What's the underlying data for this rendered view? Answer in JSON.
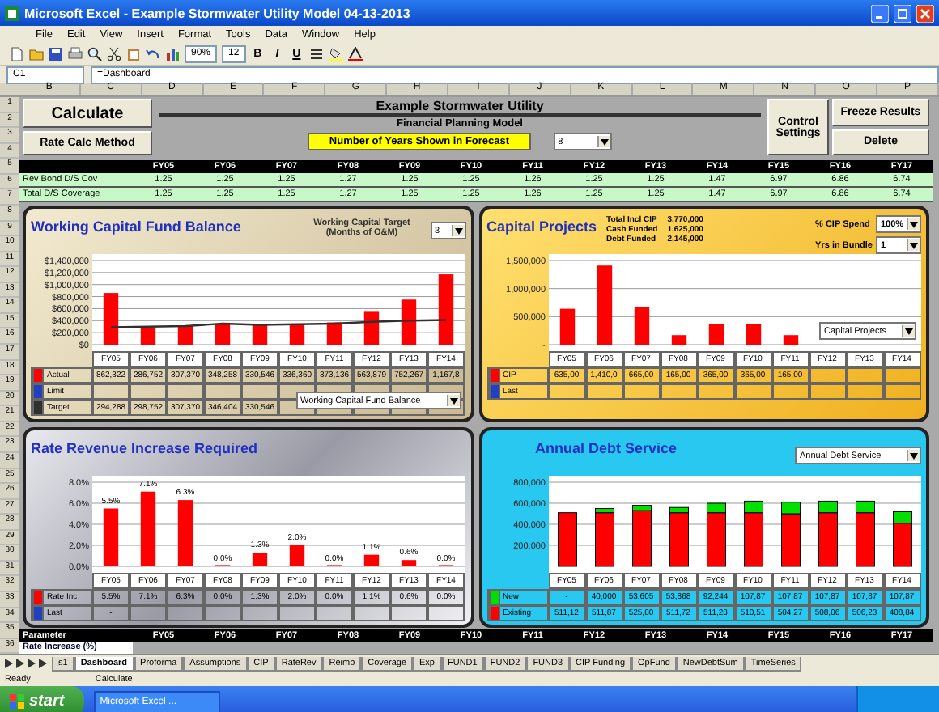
{
  "window": {
    "title": "Microsoft Excel - Example Stormwater Utility Model 04-13-2013"
  },
  "menu": [
    "File",
    "Edit",
    "View",
    "Insert",
    "Format",
    "Tools",
    "Data",
    "Window",
    "Help"
  ],
  "toolbar": {
    "zoom": "90%",
    "font_size": "12",
    "format_buttons": [
      "B",
      "I",
      "U"
    ]
  },
  "formula_bar": {
    "cell": "C1",
    "formula": "=Dashboard"
  },
  "columns": [
    "B",
    "C",
    "D",
    "E",
    "F",
    "G",
    "H",
    "I",
    "J",
    "K",
    "L",
    "M",
    "N",
    "O",
    "P"
  ],
  "row_numbers": [
    "1",
    "2",
    "3",
    "4",
    "5",
    "6",
    "7",
    "8",
    "9",
    "10",
    "11",
    "12",
    "13",
    "14",
    "15",
    "16",
    "17",
    "18",
    "19",
    "20",
    "21",
    "22",
    "23",
    "24",
    "25",
    "26",
    "27",
    "28",
    "29",
    "30",
    "31",
    "32",
    "33",
    "34",
    "35",
    "36"
  ],
  "header": {
    "calculate": "Calculate",
    "rate_calc": "Rate Calc Method",
    "title": "Example Stormwater Utility",
    "subtitle": "Financial Planning Model",
    "years_label": "Number of Years Shown in Forecast",
    "years_value": "8",
    "control_settings": "Control Settings",
    "freeze": "Freeze Results",
    "delete": "Delete"
  },
  "coverage": {
    "years": [
      "FY05",
      "FY06",
      "FY07",
      "FY08",
      "FY09",
      "FY10",
      "FY11",
      "FY12",
      "FY13",
      "FY14",
      "FY15",
      "FY16",
      "FY17"
    ],
    "rows": [
      {
        "label": "Rev Bond D/S Cov",
        "values": [
          "1.25",
          "1.25",
          "1.25",
          "1.27",
          "1.25",
          "1.25",
          "1.26",
          "1.25",
          "1.25",
          "1.47",
          "6.97",
          "6.86",
          "6.74"
        ]
      },
      {
        "label": "Total D/S Coverage",
        "values": [
          "1.25",
          "1.25",
          "1.25",
          "1.27",
          "1.25",
          "1.25",
          "1.26",
          "1.25",
          "1.25",
          "1.47",
          "6.97",
          "6.86",
          "6.74"
        ]
      }
    ]
  },
  "panels": [
    {
      "kind": "wcf",
      "title": "Working Capital Fund Balance",
      "target_label": "Working Capital Target (Months of O&M)",
      "target_value": "3",
      "selector": "Working Capital Fund Balance",
      "chart_data": {
        "type": "bar",
        "grid": true,
        "legend": "left",
        "categories": [
          "FY05",
          "FY06",
          "FY07",
          "FY08",
          "FY09",
          "FY10",
          "FY11",
          "FY12",
          "FY13",
          "FY14"
        ],
        "ylim": [
          0,
          1400000
        ],
        "yticks": [
          {
            "value": 0,
            "label": "$0"
          },
          {
            "value": 200000,
            "label": "$200,000"
          },
          {
            "value": 400000,
            "label": "$400,000"
          },
          {
            "value": 600000,
            "label": "$600,000"
          },
          {
            "value": 800000,
            "label": "$800,000"
          },
          {
            "value": 1000000,
            "label": "$1,000,000"
          },
          {
            "value": 1200000,
            "label": "$1,200,000"
          },
          {
            "value": 1400000,
            "label": "$1,400,000"
          }
        ],
        "series": [
          {
            "name": "Actual",
            "color": "#ff0000",
            "type": "bar",
            "values": [
              860000,
              290000,
              310000,
              350000,
              330000,
              340000,
              370000,
              560000,
              750000,
              1170000
            ]
          },
          {
            "name": "Target",
            "color": "#303030",
            "type": "line",
            "values": [
              290000,
              300000,
              310000,
              350000,
              330000,
              340000,
              350000,
              380000,
              400000,
              410000
            ]
          }
        ]
      },
      "table": {
        "rows": [
          {
            "kind": "series",
            "cells": [
              "862,322",
              "286,752",
              "307,370",
              "348,258",
              "330,546",
              "336,360",
              "373,136",
              "563,879",
              "752,267",
              "1,167,8"
            ]
          },
          {
            "kind": "extra",
            "label": "Limit",
            "color": "#2040c0",
            "cells": []
          },
          {
            "kind": "series",
            "cells": [
              "294,288",
              "298,752",
              "307,370",
              "346,404",
              "330,546"
            ]
          }
        ]
      }
    },
    {
      "kind": "capital",
      "title": "Capital Projects",
      "info": [
        {
          "label": "Total Incl CIP",
          "value": "3,770,000"
        },
        {
          "label": "Cash Funded",
          "value": "1,625,000"
        },
        {
          "label": "Debt Funded",
          "value": "2,145,000"
        }
      ],
      "options": [
        {
          "label": "% CIP Spend",
          "value": "100%"
        },
        {
          "label": "Yrs in Bundle",
          "value": "1"
        }
      ],
      "selector": "Capital Projects",
      "chart_data": {
        "type": "bar",
        "grid": true,
        "legend": "left",
        "categories": [
          "FY05",
          "FY06",
          "FY07",
          "FY08",
          "FY09",
          "FY10",
          "FY11",
          "FY12",
          "FY13",
          "FY14"
        ],
        "ylim": [
          0,
          1500000
        ],
        "yticks": [
          {
            "value": 0,
            "label": "-"
          },
          {
            "value": 500000,
            "label": "500,000"
          },
          {
            "value": 1000000,
            "label": "1,000,000"
          },
          {
            "value": 1500000,
            "label": "1,500,000"
          }
        ],
        "series": [
          {
            "name": "CIP",
            "color": "#ff0000",
            "type": "bar",
            "values": [
              640000,
              1410000,
              670000,
              170000,
              370000,
              370000,
              170000,
              null,
              null,
              null
            ]
          }
        ]
      },
      "table": {
        "rows": [
          {
            "kind": "series",
            "cells": [
              "635,00",
              "1,410,0",
              "665,00",
              "165,00",
              "365,00",
              "365,00",
              "165,00",
              "-",
              "-",
              "-"
            ]
          },
          {
            "kind": "extra",
            "label": "Last",
            "color": "#2040c0",
            "cells": []
          }
        ]
      }
    },
    {
      "kind": "rate",
      "title": "Rate Revenue Increase Required",
      "chart_data": {
        "type": "bar",
        "grid": true,
        "legend": "left",
        "categories": [
          "FY05",
          "FY06",
          "FY07",
          "FY08",
          "FY09",
          "FY10",
          "FY11",
          "FY12",
          "FY13",
          "FY14"
        ],
        "ylim": [
          0,
          8
        ],
        "yticks": [
          {
            "value": 0,
            "label": "0.0%"
          },
          {
            "value": 2,
            "label": "2.0%"
          },
          {
            "value": 4,
            "label": "4.0%"
          },
          {
            "value": 6,
            "label": "6.0%"
          },
          {
            "value": 8,
            "label": "8.0%"
          }
        ],
        "value_labels": [
          "5.5%",
          "7.1%",
          "6.3%",
          "0.0%",
          "1.3%",
          "2.0%",
          "0.0%",
          "1.1%",
          "0.6%",
          "0.0%"
        ],
        "series": [
          {
            "name": "Rate Inc",
            "color": "#ff0000",
            "type": "bar",
            "values": [
              5.5,
              7.1,
              6.3,
              0,
              1.3,
              2.0,
              0,
              1.1,
              0.6,
              0
            ]
          }
        ]
      },
      "table": {
        "rows": [
          {
            "kind": "series",
            "cells": [
              "5.5%",
              "7.1%",
              "6.3%",
              "0.0%",
              "1.3%",
              "2.0%",
              "0.0%",
              "1.1%",
              "0.6%",
              "0.0%"
            ]
          },
          {
            "kind": "extra",
            "label": "Last",
            "color": "#2040c0",
            "cells": [
              "-"
            ]
          }
        ]
      }
    },
    {
      "kind": "debt",
      "title": "Annual Debt Service",
      "selector": "Annual Debt Service",
      "chart_data": {
        "type": "bar",
        "stacked": true,
        "grid": true,
        "legend": "left",
        "categories": [
          "FY05",
          "FY06",
          "FY07",
          "FY08",
          "FY09",
          "FY10",
          "FY11",
          "FY12",
          "FY13",
          "FY14"
        ],
        "ylim": [
          0,
          800000
        ],
        "yticks": [
          {
            "value": 200000,
            "label": "200,000"
          },
          {
            "value": 400000,
            "label": "400,000"
          },
          {
            "value": 600000,
            "label": "600,000"
          },
          {
            "value": 800000,
            "label": "800,000"
          }
        ],
        "series": [
          {
            "name": "New",
            "color": "#00e000",
            "type": "bar",
            "values": [
              0,
              40000,
              50000,
              50000,
              90000,
              110000,
              110000,
              110000,
              110000,
              110000
            ]
          },
          {
            "name": "Existing",
            "color": "#ff0000",
            "type": "bar",
            "values": [
              510000,
              510000,
              530000,
              510000,
              510000,
              510000,
              500000,
              510000,
              510000,
              410000
            ]
          }
        ]
      },
      "table": {
        "rows": [
          {
            "kind": "series",
            "cells": [
              "-",
              "40,000",
              "53,605",
              "53,868",
              "92,244",
              "107,87",
              "107,87",
              "107,87",
              "107,87",
              "107,87"
            ]
          },
          {
            "kind": "series",
            "cells": [
              "511,12",
              "511,87",
              "525,80",
              "511,72",
              "511,28",
              "510,51",
              "504,27",
              "508,06",
              "506,23",
              "408,84"
            ]
          }
        ]
      }
    }
  ],
  "parameters": {
    "label": "Parameter",
    "years": [
      "FY05",
      "FY06",
      "FY07",
      "FY08",
      "FY09",
      "FY10",
      "FY11",
      "FY12",
      "FY13",
      "FY14",
      "FY15",
      "FY16",
      "FY17"
    ],
    "row": "Rate Increase (%)"
  },
  "sheet_tabs": [
    {
      "label": "s1",
      "selected": false
    },
    {
      "label": "Dashboard",
      "selected": true
    },
    {
      "label": "Proforma",
      "selected": false
    },
    {
      "label": "Assumptions",
      "selected": false
    },
    {
      "label": "CIP",
      "selected": false
    },
    {
      "label": "RateRev",
      "selected": false
    },
    {
      "label": "Reimb",
      "selected": false
    },
    {
      "label": "Coverage",
      "selected": false
    },
    {
      "label": "Exp",
      "selected": false
    },
    {
      "label": "FUND1",
      "selected": false
    },
    {
      "label": "FUND2",
      "selected": false
    },
    {
      "label": "FUND3",
      "selected": false
    },
    {
      "label": "CIP Funding",
      "selected": false
    },
    {
      "label": "OpFund",
      "selected": false
    },
    {
      "label": "NewDebtSum",
      "selected": false
    },
    {
      "label": "TimeSeries",
      "selected": false
    }
  ],
  "status_bar": {
    "left": "Ready",
    "mode": "Calculate"
  },
  "taskbar": {
    "start": "start",
    "tasks": [
      "Microsoft Excel ..."
    ]
  }
}
